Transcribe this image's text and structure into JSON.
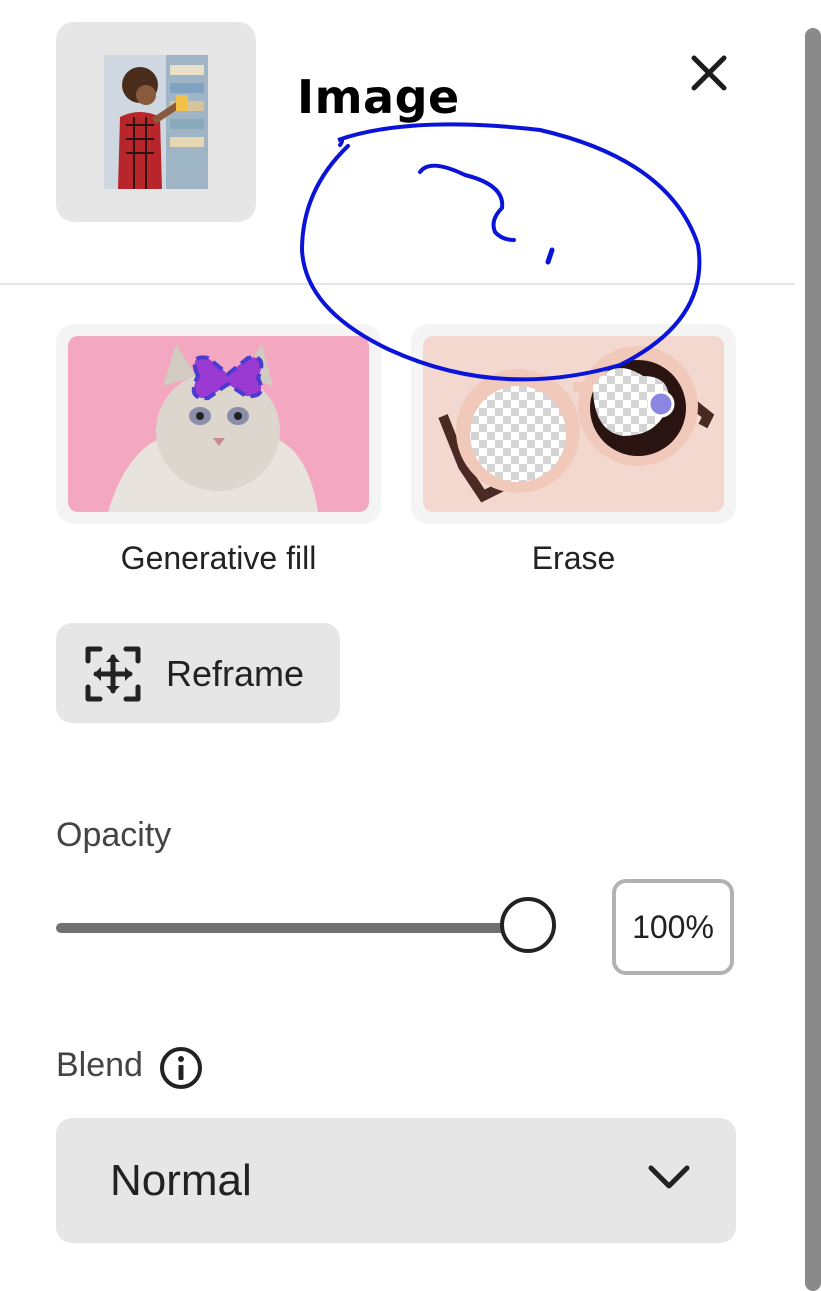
{
  "header": {
    "title": "Image",
    "close_icon": "close-icon"
  },
  "tools": [
    {
      "label": "Generative fill",
      "icon": "generative-fill-preview"
    },
    {
      "label": "Erase",
      "icon": "erase-preview"
    }
  ],
  "reframe": {
    "label": "Reframe",
    "icon": "reframe-icon"
  },
  "opacity": {
    "label": "Opacity",
    "value": 1.0,
    "value_text": "100%"
  },
  "blend": {
    "label": "Blend",
    "info_icon": "info-icon",
    "selected": "Normal",
    "chevron_icon": "chevron-down-icon"
  },
  "annotation": {
    "color": "#0a14d8",
    "shape": "hand-drawn circle with question mark"
  },
  "colors": {
    "panel": "#ffffff",
    "control_bg": "#e6e6e6",
    "accent": "#222222"
  }
}
